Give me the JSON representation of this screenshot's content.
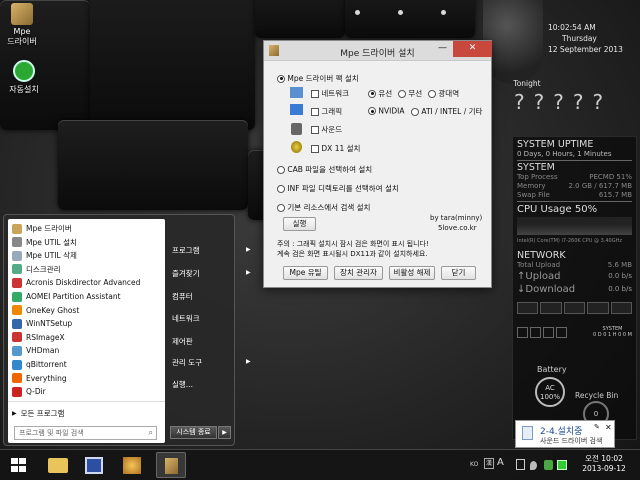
{
  "desktop": {
    "icons": [
      {
        "label_line1": "Mpe",
        "label_line2": "드라이버"
      },
      {
        "label_line1": "자동설치",
        "label_line2": ""
      }
    ]
  },
  "clock": {
    "time": "10:02:54 AM",
    "day": "Thursday",
    "date": "12 September 2013",
    "tonight": "Tonight",
    "weather_unknown": "?"
  },
  "monitor": {
    "uptime_title": "SYSTEM UPTIME",
    "uptime_value": "0 Days, 0 Hours, 1 Minutes",
    "system_title": "SYSTEM",
    "rows": [
      {
        "label": "Top Process",
        "value": "PECMD 51%"
      },
      {
        "label": "Memory",
        "value": "2.0 GB / 617.7 MB"
      },
      {
        "label": "Swap File",
        "value": "615.7 MB"
      }
    ],
    "cpu_title": "CPU Usage 50%",
    "cpu_model": "Intel(R) Core(TM) i7-260K CPU @ 3.40GHz",
    "network_title": "NETWORK",
    "net_rows": [
      {
        "label": "Total Upload",
        "value": "5.6 MB"
      },
      {
        "label": "Upload",
        "value": "0.0 b/s"
      },
      {
        "label": "Download",
        "value": "0.0 b/s"
      }
    ],
    "system_label": "SYSTEM",
    "system_counter": "0 D 0 1 H 0 0 M",
    "battery_title": "Battery",
    "battery_ac": "AC",
    "battery_pct": "100%",
    "recycle_title": "Recycle Bin",
    "recycle_count": "0"
  },
  "window": {
    "title": "Mpe 드라이버 설치",
    "pack_install": "Mpe 드라이버 팩 설치",
    "network_label": "네트워크",
    "wired": "유선",
    "wireless": "무선",
    "broadband": "광대역",
    "graphics_label": "그래픽",
    "nvidia": "NVIDIA",
    "ati_intel": "ATI / INTEL / 기타",
    "sound_label": "사운드",
    "dx_label": "DX 11 설치",
    "cab_select": "CAB 파일을 선택하여 설치",
    "inf_select": "INF 파일 디렉토리를 선택하여 설치",
    "basic_search": "기본 리소스에서 검색 설치",
    "run_button": "실행",
    "credit1": "by tara(minny)",
    "credit2": "5love.co.kr",
    "note1": "주의 : 그래픽 설치시 잠시 검은 화면이 표시 됩니다!",
    "note2": "계속 검은 화면 표시될시 DX11과 같이 설치하세요.",
    "buttons": [
      "Mpe 유틸",
      "장치 관리자",
      "비활성 해제",
      "닫기"
    ]
  },
  "start_menu": {
    "programs": [
      "Mpe 드라이버",
      "Mpe UTIL 설치",
      "Mpe UTIL 삭제",
      "디스크관리",
      "Acronis Diskdirector Advanced",
      "AOMEI Partition Assistant",
      "OneKey Ghost",
      "WinNTSetup",
      "RSImageX",
      "VHDman",
      "qBittorrent",
      "Everything",
      "Q-Dir"
    ],
    "program_colors": [
      "#c9a45a",
      "#888",
      "#9ab",
      "#5a8",
      "#c33",
      "#3a6",
      "#e80",
      "#36a",
      "#c33",
      "#59c",
      "#38c",
      "#e60",
      "#c22"
    ],
    "all_programs": "모든 프로그램",
    "search_placeholder": "프로그램 및 파일 검색",
    "right": [
      {
        "label": "프로그램",
        "arrow": "▶"
      },
      {
        "label": "즐겨찾기",
        "arrow": "▶"
      },
      {
        "label": "컴퓨터",
        "arrow": ""
      },
      {
        "label": "네트워크",
        "arrow": ""
      },
      {
        "label": "제어판",
        "arrow": ""
      },
      {
        "label": "관리 도구",
        "arrow": "▶"
      },
      {
        "label": "실행...",
        "arrow": ""
      }
    ],
    "shutdown": "시스템 종료"
  },
  "balloon": {
    "title": "2-4.설치중",
    "subtitle": "사운드 드라이버 검색"
  },
  "taskbar": {
    "lang": "KO",
    "ime": "A",
    "time_period": "오전 10:02",
    "date": "2013-09-12"
  }
}
